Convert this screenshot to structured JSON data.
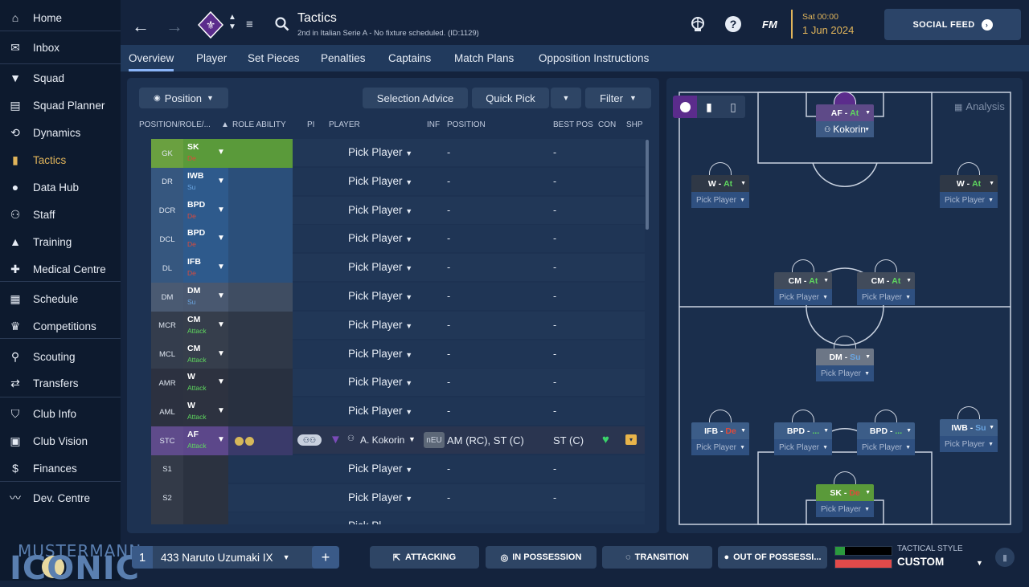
{
  "colors": {
    "bg": "#14233d",
    "sidebar": "#0d1a2e",
    "accent_gold": "#e0b45a",
    "tab_active": "#8ab4f8",
    "at_green": "#5fd85f",
    "de_red": "#e04a3a",
    "su_blue": "#6aa5e0"
  },
  "sidebar": {
    "items": [
      {
        "label": "Home",
        "icon": "home-icon"
      },
      {
        "label": "Inbox",
        "icon": "inbox-icon"
      },
      {
        "label": "Squad",
        "icon": "shirt-icon"
      },
      {
        "label": "Squad Planner",
        "icon": "clipboard-icon"
      },
      {
        "label": "Dynamics",
        "icon": "dynamics-icon"
      },
      {
        "label": "Tactics",
        "icon": "tactics-icon"
      },
      {
        "label": "Data Hub",
        "icon": "data-hub-icon"
      },
      {
        "label": "Staff",
        "icon": "staff-icon"
      },
      {
        "label": "Training",
        "icon": "training-icon"
      },
      {
        "label": "Medical Centre",
        "icon": "medical-icon"
      },
      {
        "label": "Schedule",
        "icon": "calendar-icon"
      },
      {
        "label": "Competitions",
        "icon": "trophy-icon"
      },
      {
        "label": "Scouting",
        "icon": "scouting-icon"
      },
      {
        "label": "Transfers",
        "icon": "transfers-icon"
      },
      {
        "label": "Club Info",
        "icon": "shield-icon"
      },
      {
        "label": "Club Vision",
        "icon": "briefcase-icon"
      },
      {
        "label": "Finances",
        "icon": "finances-icon"
      },
      {
        "label": "Dev. Centre",
        "icon": "dev-centre-icon"
      }
    ],
    "brand_top": "MUSTERMANN",
    "brand_bottom": "ICONIC"
  },
  "header": {
    "title": "Tactics",
    "subtitle": "2nd in Italian Serie A - No fixture scheduled. (ID:1129)",
    "fm_logo": "FM",
    "date_day": "Sat 00:00",
    "date_date": "1 Jun 2024",
    "social_feed": "SOCIAL FEED"
  },
  "tabs": [
    "Overview",
    "Player",
    "Set Pieces",
    "Penalties",
    "Captains",
    "Match Plans",
    "Opposition Instructions"
  ],
  "toolbar": {
    "position": "Position",
    "selection_advice": "Selection Advice",
    "quick_pick": "Quick Pick",
    "filter": "Filter"
  },
  "columns": {
    "pos_role": "POSITION/ROLE/...",
    "role_ability": "ROLE ABILITY",
    "pi": "PI",
    "player": "PLAYER",
    "inf": "INF",
    "position": "POSITION",
    "best_pos": "BEST POS",
    "con": "CON",
    "shp": "SHP"
  },
  "rows": [
    {
      "pos": "GK",
      "role": "SK",
      "duty": "De",
      "player": "Pick Player",
      "position": "-",
      "best_pos": "-"
    },
    {
      "pos": "DR",
      "role": "IWB",
      "duty": "Su",
      "player": "Pick Player",
      "position": "-",
      "best_pos": "-"
    },
    {
      "pos": "DCR",
      "role": "BPD",
      "duty": "De",
      "player": "Pick Player",
      "position": "-",
      "best_pos": "-"
    },
    {
      "pos": "DCL",
      "role": "BPD",
      "duty": "De",
      "player": "Pick Player",
      "position": "-",
      "best_pos": "-"
    },
    {
      "pos": "DL",
      "role": "IFB",
      "duty": "De",
      "player": "Pick Player",
      "position": "-",
      "best_pos": "-"
    },
    {
      "pos": "DM",
      "role": "DM",
      "duty": "Su",
      "player": "Pick Player",
      "position": "-",
      "best_pos": "-"
    },
    {
      "pos": "MCR",
      "role": "CM",
      "duty": "Attack",
      "player": "Pick Player",
      "position": "-",
      "best_pos": "-"
    },
    {
      "pos": "MCL",
      "role": "CM",
      "duty": "Attack",
      "player": "Pick Player",
      "position": "-",
      "best_pos": "-"
    },
    {
      "pos": "AMR",
      "role": "W",
      "duty": "Attack",
      "player": "Pick Player",
      "position": "-",
      "best_pos": "-"
    },
    {
      "pos": "AML",
      "role": "W",
      "duty": "Attack",
      "player": "Pick Player",
      "position": "-",
      "best_pos": "-"
    },
    {
      "pos": "STC",
      "role": "AF",
      "duty": "Attack",
      "player": "A. Kokorin",
      "inf": "nEU",
      "position": "AM (RC), ST (C)",
      "best_pos": "ST (C)"
    },
    {
      "pos": "S1",
      "role": "",
      "duty": "",
      "player": "Pick Player",
      "position": "-",
      "best_pos": "-"
    },
    {
      "pos": "S2",
      "role": "",
      "duty": "",
      "player": "Pick Player",
      "position": "-",
      "best_pos": "-"
    },
    {
      "pos": "",
      "role": "",
      "duty": "",
      "player": "Pick Pl...",
      "position": "",
      "best_pos": ""
    }
  ],
  "pitch": {
    "analysis": "Analysis",
    "slots": [
      {
        "role": "AF",
        "duty": "At",
        "player": "Kokorin"
      },
      {
        "role": "W",
        "duty": "At",
        "player": "Pick Player"
      },
      {
        "role": "W",
        "duty": "At",
        "player": "Pick Player"
      },
      {
        "role": "CM",
        "duty": "At",
        "player": "Pick Player"
      },
      {
        "role": "CM",
        "duty": "At",
        "player": "Pick Player"
      },
      {
        "role": "DM",
        "duty": "Su",
        "player": "Pick Player"
      },
      {
        "role": "IFB",
        "duty": "De",
        "player": "Pick Player"
      },
      {
        "role": "BPD",
        "duty": "...",
        "player": "Pick Player"
      },
      {
        "role": "BPD",
        "duty": "...",
        "player": "Pick Player"
      },
      {
        "role": "IWB",
        "duty": "Su",
        "player": "Pick Player"
      },
      {
        "role": "SK",
        "duty": "De",
        "player": "Pick Player"
      }
    ]
  },
  "bottom": {
    "tactic_num": "1",
    "tactic_name": "433 Naruto Uzumaki IX",
    "add": "+",
    "attacking": "ATTACKING",
    "in_possession": "IN POSSESSION",
    "transition": "TRANSITION",
    "out_of_possession": "OUT OF POSSESSI...",
    "tactical_style_label": "TACTICAL STYLE",
    "tactical_style_value": "CUSTOM"
  }
}
